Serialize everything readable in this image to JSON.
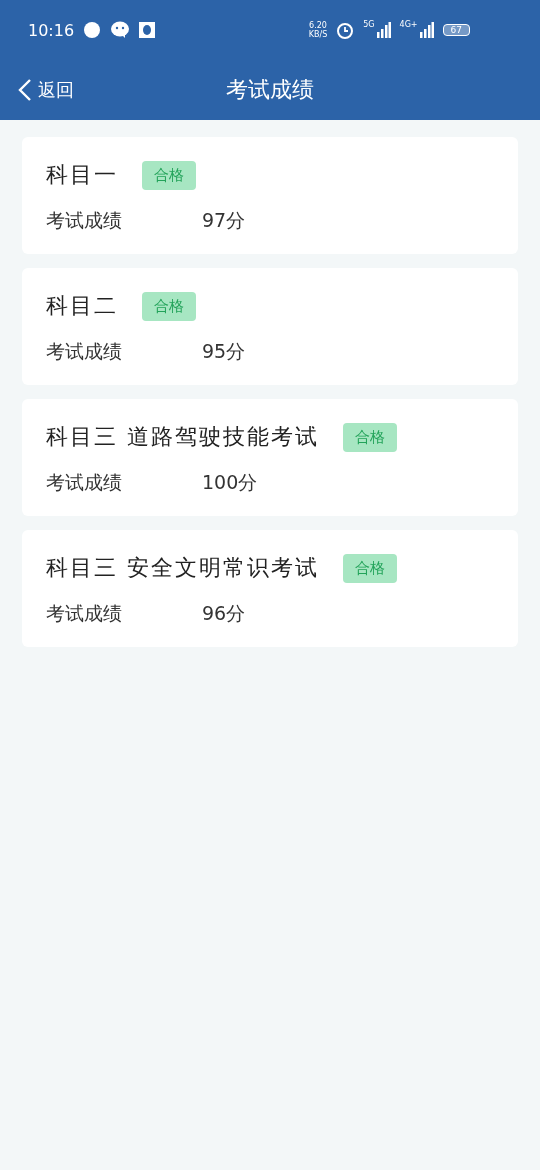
{
  "status_bar": {
    "time": "10:16",
    "speed_value": "6.20",
    "speed_unit": "KB/S",
    "network_1": "5G",
    "network_2": "4G+",
    "battery": "67"
  },
  "header": {
    "back": "返回",
    "title": "考试成绩"
  },
  "results": [
    {
      "subject": "科目一",
      "badge": "合格",
      "label": "考试成绩",
      "score": "97分"
    },
    {
      "subject": "科目二",
      "badge": "合格",
      "label": "考试成绩",
      "score": "95分"
    },
    {
      "subject": "科目三 道路驾驶技能考试",
      "badge": "合格",
      "label": "考试成绩",
      "score": "100分"
    },
    {
      "subject": "科目三 安全文明常识考试",
      "badge": "合格",
      "label": "考试成绩",
      "score": "96分"
    }
  ]
}
